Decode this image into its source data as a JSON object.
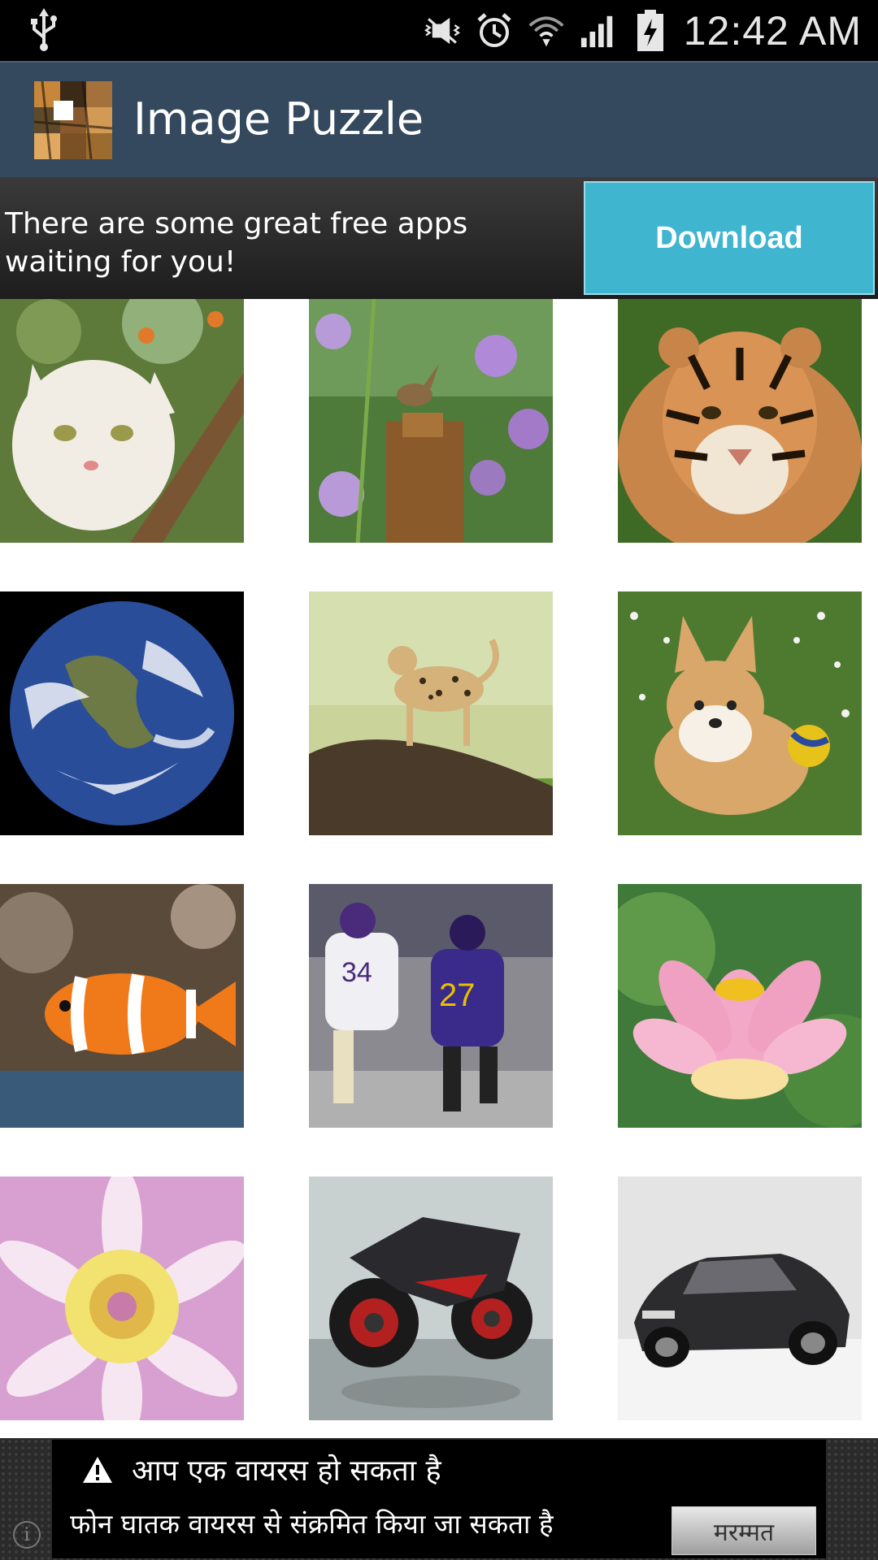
{
  "status_bar": {
    "time": "12:42 AM",
    "icons": [
      "usb-icon",
      "mute-icon",
      "alarm-icon",
      "wifi-icon",
      "signal-icon",
      "battery-charging-icon"
    ]
  },
  "app_bar": {
    "title": "Image Puzzle",
    "logo_icon": "puzzle-tiger-icon",
    "color": "#34495e"
  },
  "ad_banner": {
    "text": "There are some great free apps waiting for you!",
    "button_label": "Download",
    "button_color": "#3fb5d0"
  },
  "puzzle_grid": {
    "images": [
      {
        "subject": "white cat in tree"
      },
      {
        "subject": "bird on stump with flowers"
      },
      {
        "subject": "tiger"
      },
      {
        "subject": "earth globe"
      },
      {
        "subject": "leopard on log"
      },
      {
        "subject": "corgi puppy with ball"
      },
      {
        "subject": "clownfish"
      },
      {
        "subject": "football players"
      },
      {
        "subject": "pink lotus flower"
      },
      {
        "subject": "pink dahlia flower"
      },
      {
        "subject": "sport motorcycle"
      },
      {
        "subject": "black sports car"
      }
    ]
  },
  "bottom_ad": {
    "warning_text": "आप एक वायरस हो सकता है",
    "sub_text": "फोन घातक वायरस से संक्रमित किया जा सकता है",
    "button_label": "मरम्मत",
    "info_icon": "info-icon"
  }
}
